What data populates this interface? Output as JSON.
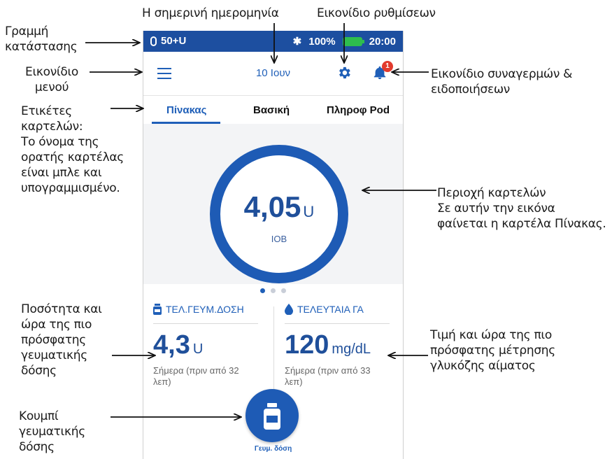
{
  "status_bar": {
    "insulin": "50+U",
    "battery": "100%",
    "time": "20:00"
  },
  "header": {
    "date": "10 Ιουν",
    "badge_count": "1"
  },
  "tabs": [
    {
      "label": "Πίνακας",
      "active": true
    },
    {
      "label": "Βασική",
      "active": false
    },
    {
      "label": "Πληροφ Pod",
      "active": false
    }
  ],
  "dashboard": {
    "iob_value": "4,05",
    "iob_unit": "U",
    "iob_label": "IOB",
    "page_dots": 3,
    "active_dot": 1
  },
  "last_bolus": {
    "title": "ΤΕΛ.ΓΕΥΜ.ΔΟΣΗ",
    "value": "4,3",
    "unit": "U",
    "subtitle": "Σήμερα (πριν από 32 λεπ)"
  },
  "last_bg": {
    "title": "ΤΕΛΕΥΤΑΙΑ ΓΑ",
    "value": "120",
    "unit": "mg/dL",
    "subtitle": "Σήμερα (πριν από 33 λεπ)"
  },
  "bolus_button": {
    "label": "Γευμ. δόση"
  },
  "annotations": {
    "status_bar": [
      "Γραμμή",
      "κατάστασης"
    ],
    "current_date": "Η σημερινή ημερομηνία",
    "settings_icon": "Εικονίδιο ρυθμίσεων",
    "menu_icon": [
      "Εικονίδιο",
      "μενού"
    ],
    "alarms_icon": [
      "Εικονίδιο συναγερμών &",
      "ειδοποιήσεων"
    ],
    "tab_labels": [
      "Ετικέτες",
      "καρτελών:",
      "Το όνομα της",
      "ορατής καρτέλας",
      "είναι μπλε και",
      "υπογραμμισμένο."
    ],
    "tab_area": [
      "Περιοχή καρτελών",
      "Σε αυτήν την εικόνα",
      "φαίνεται η καρτέλα Πίνακας."
    ],
    "bolus_info": [
      "Ποσότητα και",
      "ώρα της πιο",
      "πρόσφατης",
      "γευματικής",
      "δόσης"
    ],
    "bg_info": [
      "Τιμή και ώρα της πιο",
      "πρόσφατης μέτρησης",
      "γλυκόζης αίματος"
    ],
    "bolus_button": [
      "Κουμπί",
      "γευματικής",
      "δόσης"
    ]
  },
  "colors": {
    "primary": "#1e5bb5",
    "status_bar": "#1d4fa0",
    "badge": "#e23b2e",
    "battery": "#2ebd4e"
  }
}
